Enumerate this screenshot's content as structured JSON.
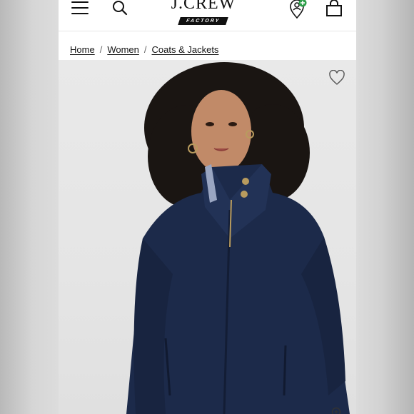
{
  "header": {
    "logo_text": "J.CREW",
    "logo_subtext": "FACTORY",
    "icons": [
      "menu-icon",
      "search-icon",
      "account-icon",
      "shopping-bag-icon"
    ],
    "account_badge_color": "#2e9e4a"
  },
  "breadcrumb": {
    "items": [
      "Home",
      "Women",
      "Coats & Jackets"
    ],
    "separator": "/"
  },
  "product": {
    "image_icons": [
      "heart-icon",
      "zoom-icon"
    ],
    "coat_color": "#1c2a4a"
  }
}
